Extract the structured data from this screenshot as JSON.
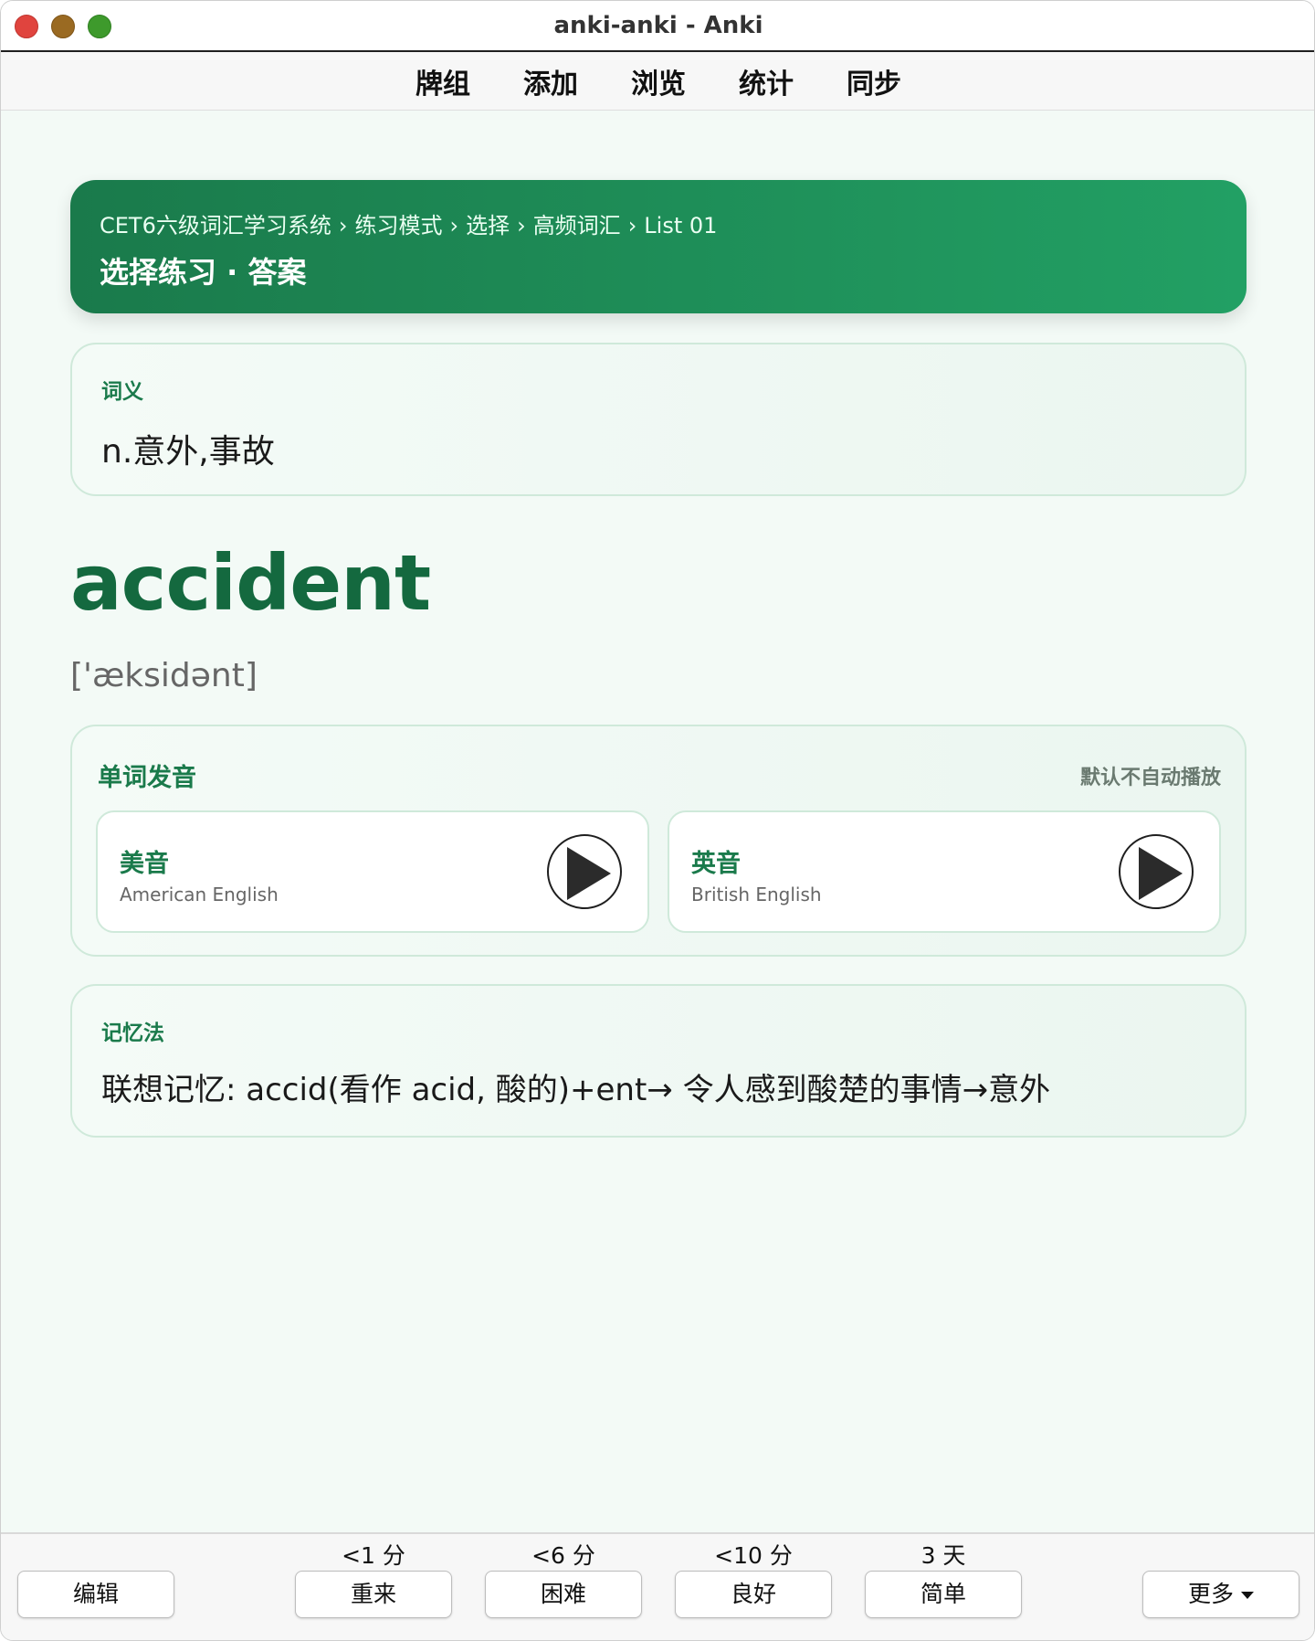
{
  "window": {
    "title": "anki-anki - Anki"
  },
  "toolbar": {
    "items": [
      "牌组",
      "添加",
      "浏览",
      "统计",
      "同步"
    ]
  },
  "header": {
    "breadcrumb": [
      "CET6六级词汇学习系统",
      "练习模式",
      "选择",
      "高频词汇",
      "List 01"
    ],
    "breadcrumb_separator": "›",
    "title": "选择练习 · 答案"
  },
  "meaning": {
    "label": "词义",
    "text": "n.意外,事故"
  },
  "word": "accident",
  "phonetic": "['æksidənt]",
  "audio": {
    "label": "单词发音",
    "note": "默认不自动播放",
    "us": {
      "name": "美音",
      "sub": "American English"
    },
    "uk": {
      "name": "英音",
      "sub": "British English"
    }
  },
  "memory": {
    "label": "记忆法",
    "text": "联想记忆: accid(看作 acid, 酸的)+ent→ 令人感到酸楚的事情→意外"
  },
  "bottom": {
    "edit_label": "编辑",
    "again": {
      "label": "重来",
      "time": "<1 分"
    },
    "hard": {
      "label": "困难",
      "time": "<6 分"
    },
    "good": {
      "label": "良好",
      "time": "<10 分"
    },
    "easy": {
      "label": "简单",
      "time": "3 天"
    },
    "more_label": "更多"
  },
  "colors": {
    "accent": "#1a7a4b",
    "word": "#14693f",
    "header_start": "#1a7a4b",
    "header_end": "#22a064"
  }
}
